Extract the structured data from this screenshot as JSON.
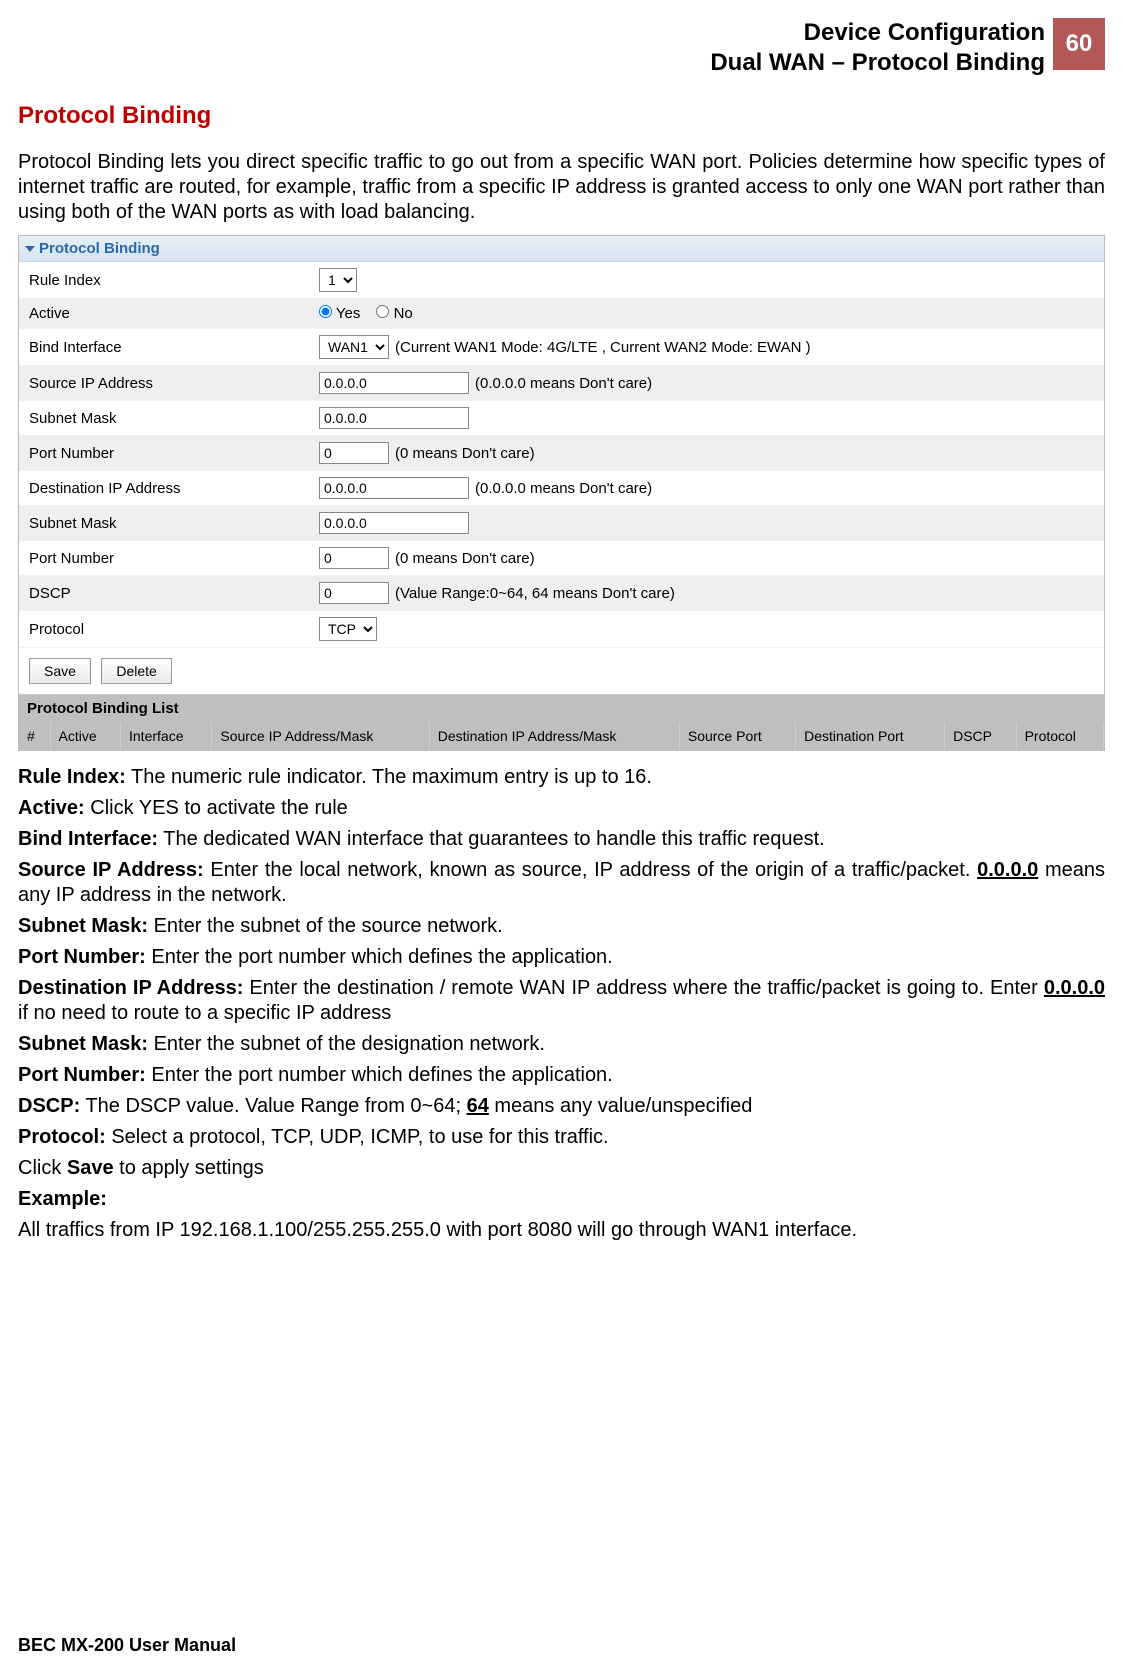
{
  "header": {
    "line1": "Device Configuration",
    "line2": "Dual WAN – Protocol Binding",
    "page_number": "60"
  },
  "section_title": "Protocol Binding",
  "intro": "Protocol Binding lets you direct specific traffic to go out from a specific WAN port. Policies determine how specific types of internet traffic are routed, for example, traffic from a specific IP address is granted access to only one WAN port rather than using both of the WAN ports as with load balancing.",
  "panel": {
    "title": "Protocol Binding",
    "rows": {
      "rule_index": {
        "label": "Rule Index",
        "value": "1"
      },
      "active": {
        "label": "Active",
        "yes": "Yes",
        "no": "No",
        "selected": "yes"
      },
      "bind_interface": {
        "label": "Bind Interface",
        "value": "WAN1",
        "hint": "(Current WAN1 Mode: 4G/LTE , Current WAN2 Mode: EWAN )"
      },
      "src_ip": {
        "label": "Source IP Address",
        "value": "0.0.0.0",
        "hint": "(0.0.0.0 means Don't care)"
      },
      "src_mask": {
        "label": "Subnet Mask",
        "value": "0.0.0.0"
      },
      "src_port": {
        "label": "Port Number",
        "value": "0",
        "hint": "(0 means Don't care)"
      },
      "dst_ip": {
        "label": "Destination IP Address",
        "value": "0.0.0.0",
        "hint": "(0.0.0.0 means Don't care)"
      },
      "dst_mask": {
        "label": "Subnet Mask",
        "value": "0.0.0.0"
      },
      "dst_port": {
        "label": "Port Number",
        "value": "0",
        "hint": "(0 means Don't care)"
      },
      "dscp": {
        "label": "DSCP",
        "value": "0",
        "hint": "(Value Range:0~64, 64 means Don't care)"
      },
      "protocol": {
        "label": "Protocol",
        "value": "TCP"
      }
    },
    "buttons": {
      "save": "Save",
      "delete": "Delete"
    },
    "list_title": "Protocol Binding List",
    "columns": {
      "num": "#",
      "active": "Active",
      "interface": "Interface",
      "src": "Source IP Address/Mask",
      "dst": "Destination IP Address/Mask",
      "sport": "Source Port",
      "dport": "Destination Port",
      "dscp": "DSCP",
      "protocol": "Protocol"
    }
  },
  "descriptions": {
    "rule_index": {
      "term": "Rule Index:",
      "text": " The numeric rule indicator. The maximum entry is up to 16."
    },
    "active": {
      "term": "Active:",
      "text": " Click YES to activate the rule"
    },
    "bind_interface": {
      "term": "Bind Interface:",
      "text": " The dedicated WAN interface that guarantees to handle this traffic request."
    },
    "src_ip": {
      "term": "Source IP Address:",
      "text_before": " Enter the local network, known as source, IP address of the origin of a traffic/packet. ",
      "underline": "0.0.0.0",
      "text_after": " means any IP address in the network."
    },
    "src_mask": {
      "term": "Subnet Mask:",
      "text": " Enter the subnet of the source network."
    },
    "src_port": {
      "term": "Port Number:",
      "text": " Enter the port number which defines the application."
    },
    "dst_ip": {
      "term": "Destination IP Address:",
      "text_before": " Enter the destination / remote WAN IP address where the traffic/packet is going to. Enter ",
      "underline": "0.0.0.0",
      "text_after": " if no need to route to a specific IP address"
    },
    "dst_mask": {
      "term": "Subnet Mask:",
      "text": " Enter the subnet of the designation network."
    },
    "dst_port": {
      "term": "Port Number:",
      "text": " Enter the port number which defines the application."
    },
    "dscp": {
      "term": "DSCP:",
      "text_before": " The DSCP value. Value Range from 0~64; ",
      "underline": "64",
      "text_after": " means any value/unspecified"
    },
    "protocol": {
      "term": "Protocol:",
      "text": " Select a protocol, TCP, UDP, ICMP, to use for this traffic."
    },
    "save_line": {
      "prefix": "Click ",
      "bold": "Save",
      "suffix": " to apply settings"
    },
    "example_label": "Example:",
    "example_text": "All traffics from IP 192.168.1.100/255.255.255.0 with port 8080 will go through WAN1 interface."
  },
  "footer": "BEC MX-200 User Manual"
}
